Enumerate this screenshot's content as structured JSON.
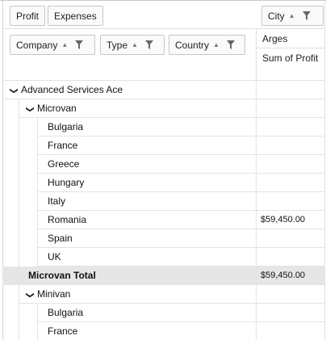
{
  "data_fields": [
    {
      "label": "Profit"
    },
    {
      "label": "Expenses"
    }
  ],
  "column_field": {
    "label": "City"
  },
  "row_fields": [
    {
      "label": "Company"
    },
    {
      "label": "Type"
    },
    {
      "label": "Country"
    }
  ],
  "column_header": {
    "city_value": "Arges",
    "measure": "Sum of Profit"
  },
  "rows": [
    {
      "kind": "group",
      "level": 0,
      "label": "Advanced Services Ace",
      "value": ""
    },
    {
      "kind": "group",
      "level": 1,
      "label": "Microvan",
      "value": ""
    },
    {
      "kind": "leaf",
      "level": 2,
      "label": "Bulgaria",
      "value": ""
    },
    {
      "kind": "leaf",
      "level": 2,
      "label": "France",
      "value": ""
    },
    {
      "kind": "leaf",
      "level": 2,
      "label": "Greece",
      "value": ""
    },
    {
      "kind": "leaf",
      "level": 2,
      "label": "Hungary",
      "value": ""
    },
    {
      "kind": "leaf",
      "level": 2,
      "label": "Italy",
      "value": ""
    },
    {
      "kind": "leaf",
      "level": 2,
      "label": "Romania",
      "value": "$59,450.00"
    },
    {
      "kind": "leaf",
      "level": 2,
      "label": "Spain",
      "value": ""
    },
    {
      "kind": "leaf",
      "level": 2,
      "label": "UK",
      "value": ""
    },
    {
      "kind": "total",
      "level": 1,
      "label": "Microvan Total",
      "value": "$59,450.00"
    },
    {
      "kind": "group",
      "level": 1,
      "label": "Minivan",
      "value": ""
    },
    {
      "kind": "leaf",
      "level": 2,
      "label": "Bulgaria",
      "value": ""
    },
    {
      "kind": "leaf",
      "level": 2,
      "label": "France",
      "value": ""
    }
  ],
  "icons": {
    "sort": "sort-ascending-icon",
    "filter": "filter-icon",
    "expand": "chevron-down-icon"
  }
}
